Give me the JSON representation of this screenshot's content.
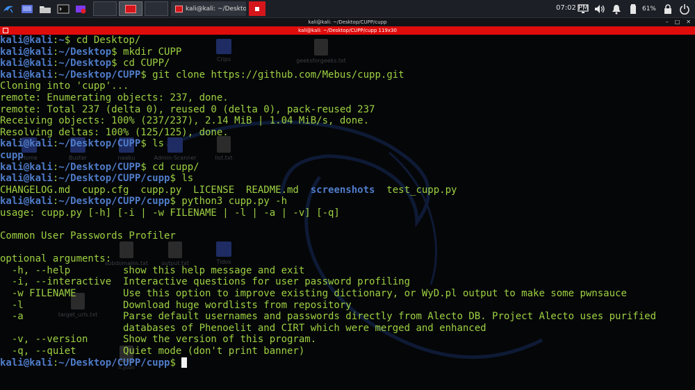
{
  "taskbar": {
    "task_main": "kali@kali: ~/Desktop/CU...",
    "clock": "07:02 PM",
    "battery": "61%",
    "colors": {
      "bar": "#1c1f26",
      "accent_red": "#d4161c"
    }
  },
  "window": {
    "title": "kali@kali: ~/Desktop/CUPP/cupp",
    "tab_label": "kali@kali: ~/Desktop/CUPP/cupp 119x30"
  },
  "desktop": {
    "icons": [
      {
        "label": "Crips",
        "kind": "folder"
      },
      {
        "label": "geeksforgeeks.txt",
        "kind": "file"
      },
      {
        "label": "Home",
        "kind": "folder"
      },
      {
        "label": "Buster",
        "kind": "folder"
      },
      {
        "label": "naabu",
        "kind": "folder"
      },
      {
        "label": "Admin-Scanner",
        "kind": "folder"
      },
      {
        "label": "list.txt",
        "kind": "file"
      },
      {
        "label": "subdomains.txt",
        "kind": "file"
      },
      {
        "label": "output.txt",
        "kind": "file"
      },
      {
        "label": "Tidos",
        "kind": "folder"
      },
      {
        "label": "target_urls.txt",
        "kind": "file"
      },
      {
        "label": "n.json",
        "kind": "file"
      }
    ]
  },
  "terminal": {
    "colors": {
      "text": "#9dd142",
      "prompt": "#4f7cc9",
      "background": "#050608"
    },
    "prompt_user": "kali@kali",
    "lines": [
      {
        "type": "prompt",
        "path": "~",
        "cmd": "cd Desktop/"
      },
      {
        "type": "prompt",
        "path": "~/Desktop",
        "cmd": "mkdir CUPP"
      },
      {
        "type": "prompt",
        "path": "~/Desktop",
        "cmd": "cd CUPP/"
      },
      {
        "type": "prompt",
        "path": "~/Desktop/CUPP",
        "cmd": "git clone https://github.com/Mebus/cupp.git"
      },
      {
        "type": "out",
        "text": "Cloning into 'cupp'..."
      },
      {
        "type": "out",
        "text": "remote: Enumerating objects: 237, done."
      },
      {
        "type": "out",
        "text": "remote: Total 237 (delta 0), reused 0 (delta 0), pack-reused 237"
      },
      {
        "type": "out",
        "text": "Receiving objects: 100% (237/237), 2.14 MiB | 1.04 MiB/s, done."
      },
      {
        "type": "out",
        "text": "Resolving deltas: 100% (125/125), done."
      },
      {
        "type": "prompt",
        "path": "~/Desktop/CUPP",
        "cmd": "ls"
      },
      {
        "type": "dirs",
        "items": [
          {
            "text": "cupp",
            "dir": true
          }
        ]
      },
      {
        "type": "prompt",
        "path": "~/Desktop/CUPP",
        "cmd": "cd cupp/"
      },
      {
        "type": "prompt",
        "path": "~/Desktop/CUPP/cupp",
        "cmd": "ls"
      },
      {
        "type": "dirs",
        "items": [
          {
            "text": "CHANGELOG.md  cupp.cfg  cupp.py  LICENSE  README.md  ",
            "dir": false
          },
          {
            "text": "screenshots",
            "dir": true
          },
          {
            "text": "  test_cupp.py",
            "dir": false
          }
        ]
      },
      {
        "type": "prompt",
        "path": "~/Desktop/CUPP/cupp",
        "cmd": "python3 cupp.py -h"
      },
      {
        "type": "out",
        "text": "usage: cupp.py [-h] [-i | -w FILENAME | -l | -a | -v] [-q]"
      },
      {
        "type": "out",
        "text": ""
      },
      {
        "type": "out",
        "text": "Common User Passwords Profiler"
      },
      {
        "type": "out",
        "text": ""
      },
      {
        "type": "out",
        "text": "optional arguments:"
      },
      {
        "type": "out",
        "text": "  -h, --help         show this help message and exit"
      },
      {
        "type": "out",
        "text": "  -i, --interactive  Interactive questions for user password profiling"
      },
      {
        "type": "out",
        "text": "  -w FILENAME        Use this option to improve existing dictionary, or WyD.pl output to make some pwnsauce"
      },
      {
        "type": "out",
        "text": "  -l                 Download huge wordlists from repository"
      },
      {
        "type": "out",
        "text": "  -a                 Parse default usernames and passwords directly from Alecto DB. Project Alecto uses purified"
      },
      {
        "type": "out",
        "text": "                     databases of Phenoelit and CIRT which were merged and enhanced"
      },
      {
        "type": "out",
        "text": "  -v, --version      Show the version of this program."
      },
      {
        "type": "out",
        "text": "  -q, --quiet        Quiet mode (don't print banner)"
      },
      {
        "type": "cursor",
        "path": "~/Desktop/CUPP/cupp"
      }
    ]
  }
}
